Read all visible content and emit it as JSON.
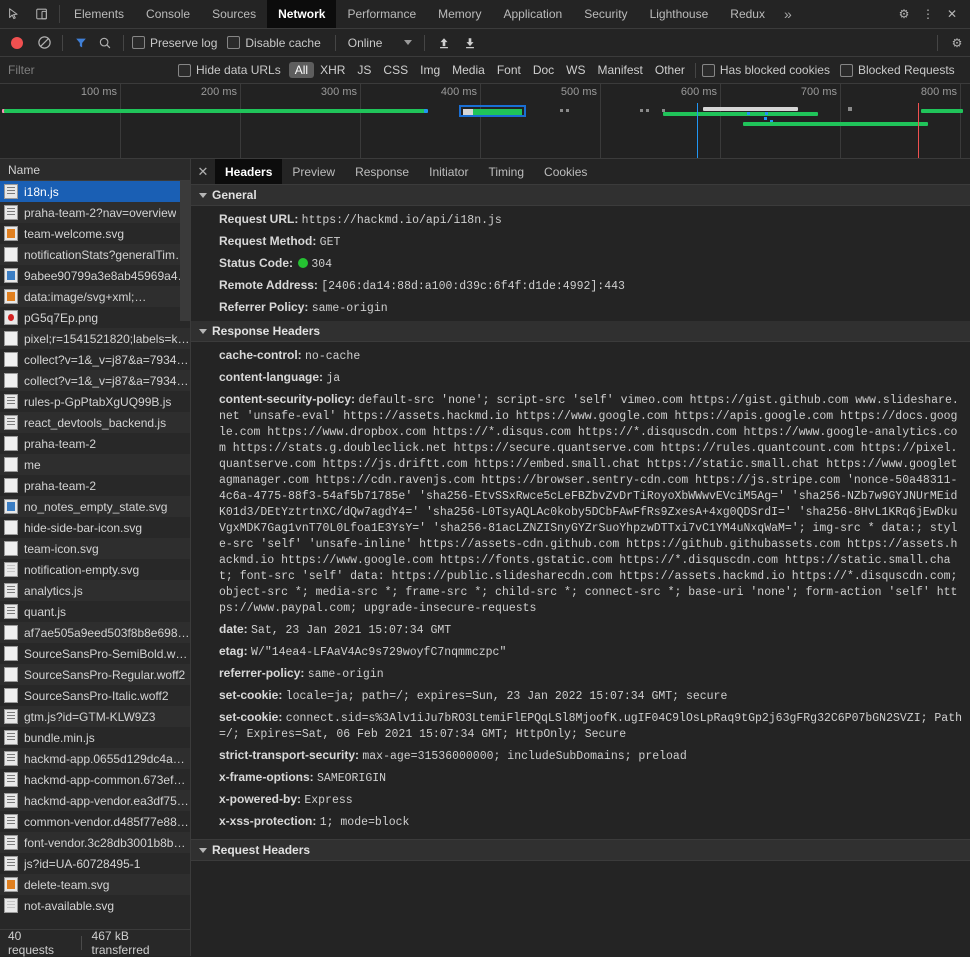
{
  "window": {
    "tabbar_icons": [
      "inspect-element-icon",
      "device-toolbar-icon"
    ],
    "tabs": [
      {
        "label": "Elements",
        "active": false
      },
      {
        "label": "Console",
        "active": false
      },
      {
        "label": "Sources",
        "active": false
      },
      {
        "label": "Network",
        "active": true
      },
      {
        "label": "Performance",
        "active": false
      },
      {
        "label": "Memory",
        "active": false
      },
      {
        "label": "Application",
        "active": false
      },
      {
        "label": "Security",
        "active": false
      },
      {
        "label": "Lighthouse",
        "active": false
      },
      {
        "label": "Redux",
        "active": false
      }
    ],
    "more_tabs": "»",
    "settings_icon": "⚙",
    "menu_icon": "⋮",
    "close_icon": "✕"
  },
  "network_toolbar": {
    "record_button": "record-button",
    "clear_button": "clear-button",
    "filter_toggle": "filter-funnel-icon",
    "search_button": "search-icon",
    "preserve_log": {
      "label": "Preserve log",
      "checked": false
    },
    "disable_cache": {
      "label": "Disable cache",
      "checked": false
    },
    "throttling": {
      "value": "Online"
    },
    "import_har": "import-har-icon",
    "export_har": "export-har-icon",
    "settings_icon": "⚙"
  },
  "filter_bar": {
    "filter_placeholder": "Filter",
    "hide_data_urls": {
      "label": "Hide data URLs",
      "checked": false
    },
    "types": [
      {
        "label": "All",
        "selected": true
      },
      {
        "label": "XHR",
        "selected": false
      },
      {
        "label": "JS",
        "selected": false
      },
      {
        "label": "CSS",
        "selected": false
      },
      {
        "label": "Img",
        "selected": false
      },
      {
        "label": "Media",
        "selected": false
      },
      {
        "label": "Font",
        "selected": false
      },
      {
        "label": "Doc",
        "selected": false
      },
      {
        "label": "WS",
        "selected": false
      },
      {
        "label": "Manifest",
        "selected": false
      },
      {
        "label": "Other",
        "selected": false
      }
    ],
    "has_blocked_cookies": {
      "label": "Has blocked cookies",
      "checked": false
    },
    "blocked_requests": {
      "label": "Blocked Requests",
      "checked": false
    }
  },
  "overview": {
    "ticks": [
      "100 ms",
      "200 ms",
      "300 ms",
      "400 ms",
      "500 ms",
      "600 ms",
      "700 ms",
      "800 ms"
    ],
    "dom_content_loaded_color": "#2196f3",
    "load_event_color": "#f05050",
    "bar_color": "#20c45a",
    "wait_color": "#d6d6d6"
  },
  "request_list": {
    "column_header": "Name",
    "rows": [
      {
        "name": "i18n.js",
        "icon": "js",
        "selected": true
      },
      {
        "name": "praha-team-2?nav=overview",
        "icon": "doc",
        "selected": false
      },
      {
        "name": "team-welcome.svg",
        "icon": "imgo",
        "selected": false
      },
      {
        "name": "notificationStats?generalTim…",
        "icon": "plain",
        "selected": false
      },
      {
        "name": "9abee90799a3e8ab45969a4…",
        "icon": "img",
        "selected": false
      },
      {
        "name": "data:image/svg+xml;…",
        "icon": "imgo",
        "selected": false
      },
      {
        "name": "pG5q7Ep.png",
        "icon": "imgr",
        "selected": false
      },
      {
        "name": "pixel;r=1541521820;labels=k…",
        "icon": "plain",
        "selected": false
      },
      {
        "name": "collect?v=1&_v=j87&a=7934…",
        "icon": "plain",
        "selected": false
      },
      {
        "name": "collect?v=1&_v=j87&a=7934…",
        "icon": "plain",
        "selected": false
      },
      {
        "name": "rules-p-GpPtabXgUQ99B.js",
        "icon": "js",
        "selected": false
      },
      {
        "name": "react_devtools_backend.js",
        "icon": "js",
        "selected": false
      },
      {
        "name": "praha-team-2",
        "icon": "plain",
        "selected": false
      },
      {
        "name": "me",
        "icon": "plain",
        "selected": false
      },
      {
        "name": "praha-team-2",
        "icon": "plain",
        "selected": false
      },
      {
        "name": "no_notes_empty_state.svg",
        "icon": "img",
        "selected": false
      },
      {
        "name": "hide-side-bar-icon.svg",
        "icon": "plain",
        "selected": false
      },
      {
        "name": "team-icon.svg",
        "icon": "plain",
        "selected": false
      },
      {
        "name": "notification-empty.svg",
        "icon": "faint",
        "selected": false
      },
      {
        "name": "analytics.js",
        "icon": "js",
        "selected": false
      },
      {
        "name": "quant.js",
        "icon": "js",
        "selected": false
      },
      {
        "name": "af7ae505a9eed503f8b8e698…",
        "icon": "plain",
        "selected": false
      },
      {
        "name": "SourceSansPro-SemiBold.w…",
        "icon": "plain",
        "selected": false
      },
      {
        "name": "SourceSansPro-Regular.woff2",
        "icon": "plain",
        "selected": false
      },
      {
        "name": "SourceSansPro-Italic.woff2",
        "icon": "plain",
        "selected": false
      },
      {
        "name": "gtm.js?id=GTM-KLW9Z3",
        "icon": "js",
        "selected": false
      },
      {
        "name": "bundle.min.js",
        "icon": "js",
        "selected": false
      },
      {
        "name": "hackmd-app.0655d129dc4a…",
        "icon": "js",
        "selected": false
      },
      {
        "name": "hackmd-app-common.673ef…",
        "icon": "js",
        "selected": false
      },
      {
        "name": "hackmd-app-vendor.ea3df75…",
        "icon": "js",
        "selected": false
      },
      {
        "name": "common-vendor.d485f77e88…",
        "icon": "js",
        "selected": false
      },
      {
        "name": "font-vendor.3c28db3001b8b…",
        "icon": "js",
        "selected": false
      },
      {
        "name": "js?id=UA-60728495-1",
        "icon": "js",
        "selected": false
      },
      {
        "name": "delete-team.svg",
        "icon": "imgo",
        "selected": false
      },
      {
        "name": "not-available.svg",
        "icon": "faint",
        "selected": false
      }
    ],
    "footer": {
      "requests": "40 requests",
      "transferred": "467 kB transferred"
    }
  },
  "detail": {
    "close_icon": "✕",
    "tabs": [
      {
        "label": "Headers",
        "active": true
      },
      {
        "label": "Preview",
        "active": false
      },
      {
        "label": "Response",
        "active": false
      },
      {
        "label": "Initiator",
        "active": false
      },
      {
        "label": "Timing",
        "active": false
      },
      {
        "label": "Cookies",
        "active": false
      }
    ],
    "general": {
      "title": "General",
      "rows": [
        {
          "name": "Request URL:",
          "value": "https://hackmd.io/api/i18n.js"
        },
        {
          "name": "Request Method:",
          "value": "GET"
        },
        {
          "name": "Status Code:",
          "value": "304",
          "status_dot": true
        },
        {
          "name": "Remote Address:",
          "value": "[2406:da14:88d:a100:d39c:6f4f:d1de:4992]:443"
        },
        {
          "name": "Referrer Policy:",
          "value": "same-origin"
        }
      ]
    },
    "response_headers": {
      "title": "Response Headers",
      "rows": [
        {
          "name": "cache-control:",
          "value": "no-cache"
        },
        {
          "name": "content-language:",
          "value": "ja"
        },
        {
          "name": "content-security-policy:",
          "value": "default-src 'none'; script-src 'self' vimeo.com https://gist.github.com www.slideshare.net 'unsafe-eval' https://assets.hackmd.io https://www.google.com https://apis.google.com https://docs.google.com https://www.dropbox.com https://*.disqus.com https://*.disquscdn.com https://www.google-analytics.com https://stats.g.doubleclick.net https://secure.quantserve.com https://rules.quantcount.com https://pixel.quantserve.com https://js.driftt.com https://embed.small.chat https://static.small.chat https://www.googletagmanager.com https://cdn.ravenjs.com https://browser.sentry-cdn.com https://js.stripe.com 'nonce-50a48311-4c6a-4775-88f3-54af5b71785e' 'sha256-EtvSSxRwce5cLeFBZbvZvDrTiRoyoXbWWwvEVciM5Ag=' 'sha256-NZb7w9GYJNUrMEidK01d3/DEtYztrtnXC/dQw7agdY4=' 'sha256-L0TsyAQLAc0koby5DCbFAwFfRs9ZxesA+4xg0QDSrdI=' 'sha256-8HvL1KRq6jEwDkuVgxMDK7Gag1vnT70L0Lfoa1E3YsY=' 'sha256-81acLZNZISnyGYZrSuoYhpzwDTTxi7vC1YM4uNxqWaM='; img-src * data:; style-src 'self' 'unsafe-inline' https://assets-cdn.github.com https://github.githubassets.com https://assets.hackmd.io https://www.google.com https://fonts.gstatic.com https://*.disquscdn.com https://static.small.chat; font-src 'self' data: https://public.slidesharecdn.com https://assets.hackmd.io https://*.disquscdn.com; object-src *; media-src *; frame-src *; child-src *; connect-src *; base-uri 'none'; form-action 'self' https://www.paypal.com; upgrade-insecure-requests"
        },
        {
          "name": "date:",
          "value": "Sat, 23 Jan 2021 15:07:34 GMT"
        },
        {
          "name": "etag:",
          "value": "W/\"14ea4-LFAaV4Ac9s729woyfC7nqmmczpc\""
        },
        {
          "name": "referrer-policy:",
          "value": "same-origin"
        },
        {
          "name": "set-cookie:",
          "value": "locale=ja; path=/; expires=Sun, 23 Jan 2022 15:07:34 GMT; secure"
        },
        {
          "name": "set-cookie:",
          "value": "connect.sid=s%3Alv1iJu7bRO3LtemiFlEPQqLSl8MjoofK.ugIF04C9lOsLpRaq9tGp2j63gFRg32C6P07bGN2SVZI; Path=/; Expires=Sat, 06 Feb 2021 15:07:34 GMT; HttpOnly; Secure"
        },
        {
          "name": "strict-transport-security:",
          "value": "max-age=31536000000; includeSubDomains; preload"
        },
        {
          "name": "x-frame-options:",
          "value": "SAMEORIGIN"
        },
        {
          "name": "x-powered-by:",
          "value": "Express"
        },
        {
          "name": "x-xss-protection:",
          "value": "1; mode=block"
        }
      ]
    },
    "request_headers": {
      "title": "Request Headers"
    }
  }
}
